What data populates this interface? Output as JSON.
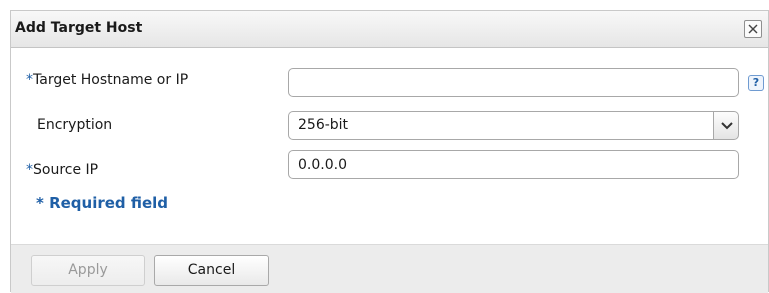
{
  "dialog": {
    "title": "Add Target Host"
  },
  "form": {
    "required_marker": "*",
    "target_host": {
      "label": "Target Hostname or IP",
      "value": ""
    },
    "help_icon_glyph": "?",
    "encryption": {
      "label": "Encryption",
      "selected": "256-bit"
    },
    "source_ip": {
      "label": "Source IP",
      "value": "0.0.0.0"
    },
    "required_note": "* Required field"
  },
  "footer": {
    "apply_label": "Apply",
    "cancel_label": "Cancel"
  },
  "icons": {
    "close": "close-icon",
    "help": "help-icon",
    "dropdown": "chevron-down-icon"
  },
  "colors": {
    "accent": "#1f5fa6",
    "footer_bg": "#ececec",
    "titlebar_bg": "#e6e6e6"
  }
}
